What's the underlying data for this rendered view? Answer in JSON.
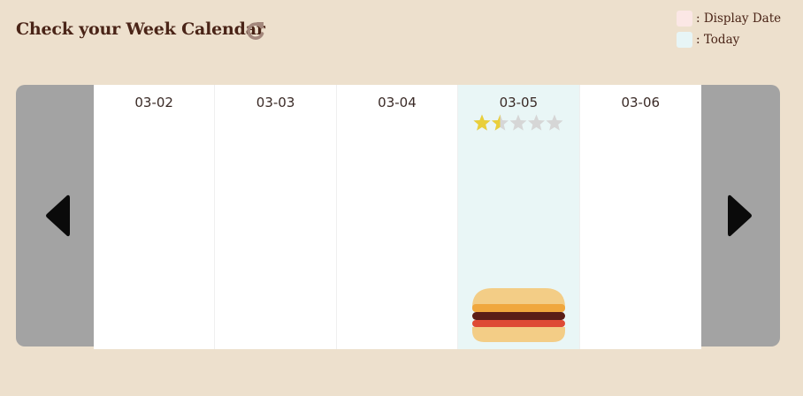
{
  "header": {
    "title": "Check your Week Calendar",
    "refresh_icon": "refresh-icon"
  },
  "legend": {
    "display_date": ": Display Date",
    "today": ": Today",
    "colors": {
      "display_date": "#fbe7e5",
      "today": "#e7f5f6"
    }
  },
  "nav": {
    "prev_icon": "triangle-left-icon",
    "next_icon": "triangle-right-icon"
  },
  "days": [
    {
      "date": "03-02"
    },
    {
      "date": "03-03"
    },
    {
      "date": "03-04"
    },
    {
      "date": "03-05",
      "today": true,
      "rating": 1.5,
      "rating_max": 5,
      "food_icon": "hamburger-icon"
    },
    {
      "date": "03-06"
    }
  ],
  "colors": {
    "background": "#ede0cd",
    "title": "#4a2417",
    "nav_bg": "#a3a3a3",
    "today_bg": "#e9f6f6",
    "star_filled": "#e9cf3a",
    "star_empty": "#d6d6d6"
  }
}
